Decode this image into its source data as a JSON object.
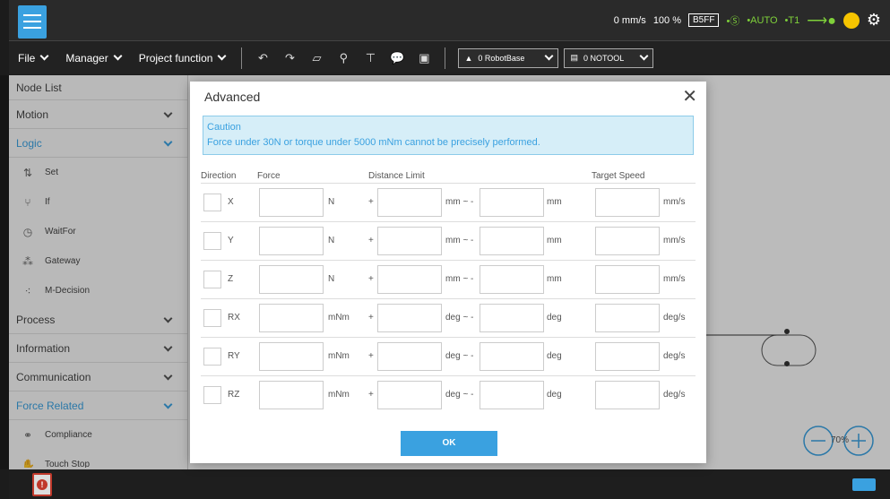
{
  "topbar": {
    "speed": "0 mm/s",
    "percent": "100 %",
    "code": "B5FF",
    "mode_s": "•Ⓢ",
    "mode_auto": "•AUTO",
    "mode_t1": "•T1"
  },
  "menubar": {
    "file": "File",
    "manager": "Manager",
    "project_function": "Project function",
    "base": "0 RobotBase",
    "tool": "0 NOTOOL"
  },
  "sidebar": {
    "title": "Node List",
    "categories": {
      "motion": "Motion",
      "logic": "Logic",
      "process": "Process",
      "information": "Information",
      "communication": "Communication",
      "force_related": "Force Related"
    },
    "logic_items": [
      "Set",
      "If",
      "WaitFor",
      "Gateway",
      "M-Decision"
    ],
    "force_items": [
      "Compliance",
      "Touch Stop"
    ]
  },
  "canvas": {
    "zoom": "70%"
  },
  "modal": {
    "title": "Advanced",
    "caution_title": "Caution",
    "caution_text": "Force under 30N or torque under 5000 mNm cannot be precisely performed.",
    "headers": {
      "direction": "Direction",
      "force": "Force",
      "distance_limit": "Distance Limit",
      "target_speed": "Target Speed"
    },
    "plus": "+",
    "rows": [
      {
        "dir": "X",
        "force_unit": "N",
        "mid": "mm ~ -",
        "dist_unit": "mm",
        "speed_unit": "mm/s"
      },
      {
        "dir": "Y",
        "force_unit": "N",
        "mid": "mm ~ -",
        "dist_unit": "mm",
        "speed_unit": "mm/s"
      },
      {
        "dir": "Z",
        "force_unit": "N",
        "mid": "mm ~ -",
        "dist_unit": "mm",
        "speed_unit": "mm/s"
      },
      {
        "dir": "RX",
        "force_unit": "mNm",
        "mid": "deg ~ -",
        "dist_unit": "deg",
        "speed_unit": "deg/s"
      },
      {
        "dir": "RY",
        "force_unit": "mNm",
        "mid": "deg ~ -",
        "dist_unit": "deg",
        "speed_unit": "deg/s"
      },
      {
        "dir": "RZ",
        "force_unit": "mNm",
        "mid": "deg ~ -",
        "dist_unit": "deg",
        "speed_unit": "deg/s"
      }
    ],
    "ok": "OK"
  }
}
